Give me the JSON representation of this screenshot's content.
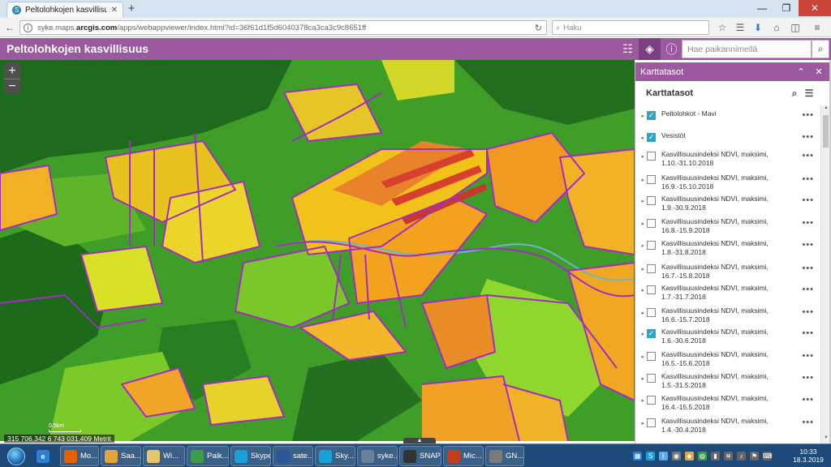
{
  "browser": {
    "tab_title": "Peltolohkojen kasvillisuus",
    "new_tab_symbol": "+",
    "url_prefix": "syke.maps.",
    "url_bold": "arcgis.com",
    "url_rest": "/apps/webappviewer/index.html?id=36f61d1f5d6040378ca3ca3c9c8651ff",
    "search_placeholder": "Haku"
  },
  "app": {
    "title": "Peltolohkojen kasvillisuus",
    "geosearch_placeholder": "Hae paikannimellä",
    "accent_color": "#9b5aa0"
  },
  "map": {
    "zoom_in": "+",
    "zoom_out": "−",
    "scale_label": "0.5km",
    "coordinates": "315 706,342 6 743 031,409 Metrit"
  },
  "panel": {
    "header": "Karttatasot",
    "subheader": "Karttatasot",
    "layers": [
      {
        "label": "Peltolohkot - Mavi",
        "checked": true
      },
      {
        "label": "Vesistöt",
        "checked": true
      },
      {
        "label": "Kasvillisuusindeksi NDVI, maksimi, 1.10.-31.10.2018",
        "checked": false
      },
      {
        "label": "Kasvillisuusindeksi NDVI, maksimi, 16.9.-15.10.2018",
        "checked": false
      },
      {
        "label": "Kasvillisuusindeksi NDVI, maksimi, 1.9.-30.9.2018",
        "checked": false
      },
      {
        "label": "Kasvillisuusindeksi NDVI, maksimi, 16.8.-15.9.2018",
        "checked": false
      },
      {
        "label": "Kasvillisuusindeksi NDVI, maksimi, 1.8.-31.8.2018",
        "checked": false
      },
      {
        "label": "Kasvillisuusindeksi NDVI, maksimi, 16.7.-15.8.2018",
        "checked": false
      },
      {
        "label": "Kasvillisuusindeksi NDVI, maksimi, 1.7.-31.7.2018",
        "checked": false
      },
      {
        "label": "Kasvillisuusindeksi NDVI, maksimi, 16.6.-15.7.2018",
        "checked": false
      },
      {
        "label": "Kasvillisuusindeksi NDVI, maksimi, 1.6.-30.6.2018",
        "checked": true
      },
      {
        "label": "Kasvillisuusindeksi NDVI, maksimi, 16.5.-15.6.2018",
        "checked": false
      },
      {
        "label": "Kasvillisuusindeksi NDVI, maksimi, 1.5.-31.5.2018",
        "checked": false
      },
      {
        "label": "Kasvillisuusindeksi NDVI, maksimi, 16.4.-15.5.2018",
        "checked": false
      },
      {
        "label": "Kasvillisuusindeksi NDVI, maksimi, 1.4.-30.4.2018",
        "checked": false
      }
    ],
    "more_symbol": "•••"
  },
  "taskbar": {
    "items": [
      {
        "label": "Mo...",
        "icon": "firefox-icon",
        "color": "#e66000"
      },
      {
        "label": "Saa...",
        "icon": "outlook-icon",
        "color": "#e8a33a"
      },
      {
        "label": "Wi...",
        "icon": "folder-icon",
        "color": "#e9c46a"
      },
      {
        "label": "Paik...",
        "icon": "chrome-icon",
        "color": "#3d9b4a"
      },
      {
        "label": "Skype",
        "icon": "skype-icon",
        "color": "#1a9fd9"
      },
      {
        "label": "sate...",
        "icon": "word-icon",
        "color": "#2b5797"
      },
      {
        "label": "Sky...",
        "icon": "skype-icon",
        "color": "#1a9fd9"
      },
      {
        "label": "syke...",
        "icon": "app-icon",
        "color": "#6a7f99"
      },
      {
        "label": "SNAP",
        "icon": "snap-icon",
        "color": "#333333"
      },
      {
        "label": "Mic...",
        "icon": "powerpoint-icon",
        "color": "#c43e1c"
      },
      {
        "label": "GN...",
        "icon": "gnss-icon",
        "color": "#7a7a7a"
      }
    ],
    "time": "10:33",
    "date": "18.3.2019"
  }
}
